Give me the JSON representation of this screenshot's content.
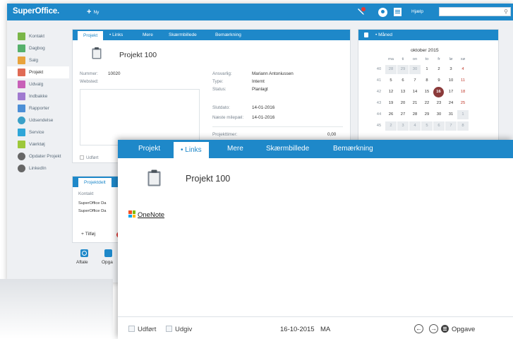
{
  "app": {
    "logo": "SuperOffice.",
    "new_label": "Ny",
    "help_label": "Hjælp",
    "search_placeholder": ""
  },
  "sidebar": {
    "items": [
      {
        "label": "Kontakt",
        "color": "#7ab648"
      },
      {
        "label": "Dagbog",
        "color": "#56b06b"
      },
      {
        "label": "Salg",
        "color": "#e8a33d"
      },
      {
        "label": "Projekt",
        "color": "#e06b55"
      },
      {
        "label": "Udvalg",
        "color": "#c860b8"
      },
      {
        "label": "Indbakke",
        "color": "#a07ad0"
      },
      {
        "label": "Rapporter",
        "color": "#4c8fd6"
      },
      {
        "label": "Udsendelse",
        "color": "#3aa0c8"
      },
      {
        "label": "Service",
        "color": "#2fa6d8"
      },
      {
        "label": "Værktøj",
        "color": "#9dc83a"
      },
      {
        "label": "Opdater Projekt",
        "color": "#666666"
      },
      {
        "label": "LinkedIn",
        "color": "#666666"
      }
    ]
  },
  "back_project": {
    "tabs": [
      "Projekt",
      "Links",
      "Mere",
      "Skærmbillede",
      "Bemærkning"
    ],
    "title": "Projekt 100",
    "number_label": "Nummer:",
    "number_value": "10020",
    "website_label": "Websted:",
    "responsible_label": "Ansvarlig:",
    "responsible_value": "Mariann Antoniussen",
    "type_label": "Type:",
    "type_value": "Internt",
    "status_label": "Status:",
    "status_value": "Planlagt",
    "end_label": "Slutdato:",
    "end_value": "14-01-2016",
    "milestone_label": "Næste milepæl:",
    "milestone_value": "14-01-2016",
    "hours_label": "Projekttimer:",
    "hours_value": "0,00",
    "done_label": "Udført"
  },
  "participants": {
    "tab": "Projektdelt",
    "column": "Kontakt",
    "rows": [
      "SuperOffice Da",
      "SuperOffice Da"
    ],
    "add_label": "+ Tilføj"
  },
  "bottom_actions": {
    "appointment": "Aftale",
    "task": "Opga"
  },
  "calendar": {
    "view_label": "Måned",
    "month_label": "oktober 2015",
    "weekdays": [
      "ma",
      "ti",
      "on",
      "to",
      "fr",
      "lø",
      "sø"
    ],
    "weeks": [
      {
        "wk": "40",
        "days": [
          "28",
          "29",
          "30",
          "1",
          "2",
          "3",
          "4"
        ]
      },
      {
        "wk": "41",
        "days": [
          "5",
          "6",
          "7",
          "8",
          "9",
          "10",
          "11"
        ]
      },
      {
        "wk": "42",
        "days": [
          "12",
          "13",
          "14",
          "15",
          "16",
          "17",
          "18"
        ]
      },
      {
        "wk": "43",
        "days": [
          "19",
          "20",
          "21",
          "22",
          "23",
          "24",
          "25"
        ]
      },
      {
        "wk": "44",
        "days": [
          "26",
          "27",
          "28",
          "29",
          "30",
          "31",
          "1"
        ]
      },
      {
        "wk": "45",
        "days": [
          "2",
          "3",
          "4",
          "5",
          "6",
          "7",
          "8"
        ]
      }
    ],
    "today": "16"
  },
  "front_project": {
    "tabs": [
      "Projekt",
      "Links",
      "Mere",
      "Skærmbillede",
      "Bemærkning"
    ],
    "active_tab": "Links",
    "title": "Projekt 100",
    "link_label": "OneNote",
    "done_label": "Udført",
    "publish_label": "Udgiv",
    "date": "16-10-2015",
    "initials": "MA",
    "task_label": "Opgave"
  },
  "colors": {
    "brand": "#1e88c9",
    "today": "#8b3a3a"
  }
}
